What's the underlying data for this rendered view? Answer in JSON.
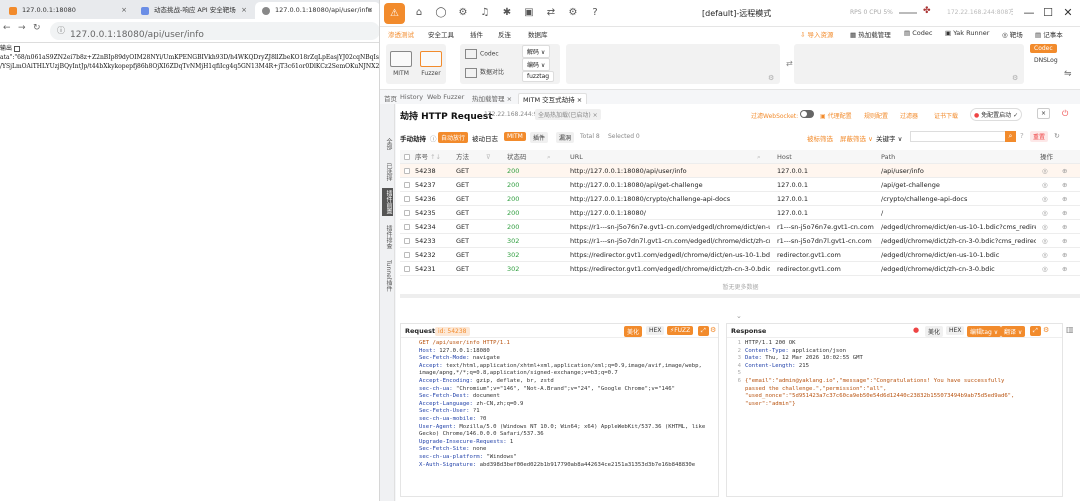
{
  "browser": {
    "tabs": [
      {
        "label": "127.0.0.1:18080",
        "active": false
      },
      {
        "label": "动态挑战-响应 API 安全靶场",
        "active": false
      },
      {
        "label": "127.0.0.1:18080/api/user/info",
        "active": true
      }
    ],
    "address": "127.0.0.1:18080/api/user/info",
    "content_lines": [
      "输出",
      "ata\":\"68/n061aS9ZN2ei7b8z+Z2nBIp89dyOIM28NYi/UmKPENGBIVkh93D/h4WKQDryZJ8llZbeKO18rZqLpEasjYJ02cqNBqIscfcbr",
      "/YSjLmOAiTHLYUzjBQyIntJp/t44bXkykopepfj86h8OjXI6ZDqTvNMjH1qfiIcg4q5GN13M4R+jT3c61or0DlKCz2SemOKuNJNX2Ilg"
    ]
  },
  "app": {
    "title": "[default]-远程模式",
    "stats": "RPS 0  CPU 5%",
    "ip": "172.22.168.244:8087",
    "menu": [
      "渗透测试",
      "安全工具",
      "插件",
      "反连",
      "数据库"
    ],
    "menu_right": [
      "导入资源",
      "热加载管理",
      "Codec",
      "Yak Runner",
      "靶场",
      "记事本"
    ],
    "tools": [
      "MITM",
      "Fuzzer",
      "Codec",
      "数据对比",
      "解码",
      "编码",
      "fuzztag"
    ],
    "side_tags": [
      "Codec",
      "DNSLog"
    ],
    "subtabs": [
      "首页",
      "History",
      "Web Fuzzer",
      "热加载管理",
      "MITM 交互式劫持"
    ],
    "vertical_sidebar": [
      "全部",
      "已选择",
      "插件前置",
      "插件排查",
      "Tunnel插件"
    ],
    "header": {
      "title": "劫持 HTTP Request",
      "addr": "172.22.168.244:9999",
      "mode": "全局热加载(已启动)",
      "ws_label": "过滤WebSocket:",
      "buttons": [
        "代理配置",
        "规则配置",
        "过滤器",
        "证书下载"
      ],
      "auto_forward": "免配置启动",
      "stop": "×"
    },
    "filter_row": {
      "hijack_label": "手动劫持",
      "auto_label": "自动放行",
      "log_label": "被动日志",
      "mitm_tag": "MITM",
      "plugin_tag": "插件",
      "risk_tag": "漏洞",
      "total": "Total 8",
      "selected": "Selected 0",
      "filter_left": "被标筛选",
      "filter_right": "屏蔽筛选",
      "keyword_label": "关键字",
      "reset": "重置"
    },
    "table": {
      "headers": [
        "序号",
        "方法",
        "状态码",
        "URL",
        "Host",
        "Path",
        "操作"
      ],
      "rows": [
        {
          "id": "54238",
          "method": "GET",
          "status": "200",
          "url": "http://127.0.0.1:18080/api/user/info",
          "host": "127.0.0.1",
          "path": "/api/user/info"
        },
        {
          "id": "54237",
          "method": "GET",
          "status": "200",
          "url": "http://127.0.0.1:18080/api/get-challenge",
          "host": "127.0.0.1",
          "path": "/api/get-challenge"
        },
        {
          "id": "54236",
          "method": "GET",
          "status": "200",
          "url": "http://127.0.0.1:18080/crypto/challenge-api-docs",
          "host": "127.0.0.1",
          "path": "/crypto/challenge-api-docs"
        },
        {
          "id": "54235",
          "method": "GET",
          "status": "200",
          "url": "http://127.0.0.1:18080/",
          "host": "127.0.0.1",
          "path": "/"
        },
        {
          "id": "54234",
          "method": "GET",
          "status": "200",
          "url": "https://r1---sn-j5o76n7e.gvt1-cn.com/edgedl/chrome/dict/en-us-10-...",
          "host": "r1---sn-j5o76n7e.gvt1-cn.com",
          "path": "/edgedl/chrome/dict/en-us-10-1.bdic?cms_redirect=yes"
        },
        {
          "id": "54233",
          "method": "GET",
          "status": "302",
          "url": "https://r1---sn-j5o7dn7l.gvt1-cn.com/edgedl/chrome/dict/zh-cn-3-0...",
          "host": "r1---sn-j5o7dn7l.gvt1-cn.com",
          "path": "/edgedl/chrome/dict/zh-cn-3-0.bdic?cms_redirect=yes"
        },
        {
          "id": "54232",
          "method": "GET",
          "status": "302",
          "url": "https://redirector.gvt1.com/edgedl/chrome/dict/en-us-10-1.bdic",
          "host": "redirector.gvt1.com",
          "path": "/edgedl/chrome/dict/en-us-10-1.bdic"
        },
        {
          "id": "54231",
          "method": "GET",
          "status": "302",
          "url": "https://redirector.gvt1.com/edgedl/chrome/dict/zh-cn-3-0.bdic",
          "host": "redirector.gvt1.com",
          "path": "/edgedl/chrome/dict/zh-cn-3-0.bdic"
        }
      ],
      "footer": "暂无更多数据"
    },
    "request": {
      "title": "Request",
      "id_tag": "id: 54238",
      "buttons": [
        "美化",
        "HEX",
        "FUZZ"
      ],
      "lines": [
        "GET /api/user/info HTTP/1.1",
        "Host: 127.0.0.1:18080",
        "Sec-Fetch-Mode: navigate",
        "Accept: text/html,application/xhtml+xml,application/xml;q=0.9,image/avif,image/webp,",
        "image/apng,*/*;q=0.8,application/signed-exchange;v=b3;q=0.7",
        "Accept-Encoding: gzip, deflate, br, zstd",
        "sec-ch-ua: \"Chromium\";v=\"146\", \"Not-A.Brand\";v=\"24\", \"Google Chrome\";v=\"146\"",
        "Sec-Fetch-Dest: document",
        "Accept-Language: zh-CN,zh;q=0.9",
        "Sec-Fetch-User: ?1",
        "sec-ch-ua-mobile: ?0",
        "User-Agent: Mozilla/5.0 (Windows NT 10.0; Win64; x64) AppleWebKit/537.36 (KHTML, like",
        "Gecko) Chrome/146.0.0.0 Safari/537.36",
        "Upgrade-Insecure-Requests: 1",
        "Sec-Fetch-Site: none",
        "sec-ch-ua-platform: \"Windows\"",
        "X-Auth-Signature: abd398d3bef00ed022b1b917790ab8a442634ce2151a31353d3b7e16b848830e"
      ]
    },
    "response": {
      "title": "Response",
      "buttons": [
        "美化",
        "HEX",
        "编辑tag",
        "翻译"
      ],
      "lines": [
        {
          "n": "1",
          "t": "HTTP/1.1 200 OK"
        },
        {
          "n": "2",
          "t": "Content-Type: application/json"
        },
        {
          "n": "3",
          "t": "Date: Thu, 12 Mar 2026 10:02:55 GMT"
        },
        {
          "n": "4",
          "t": "Content-Length: 215"
        },
        {
          "n": "5",
          "t": ""
        },
        {
          "n": "6",
          "t": "{\"email\":\"admin@yaklang.io\",\"message\":\"Congratulations! You have successfully"
        },
        {
          "n": "",
          "t": "passed the challenge.\",\"permission\":\"all\","
        },
        {
          "n": "",
          "t": "\"used_nonce\":\"5d951423a7c37c60ca9eb50e54d6d12440c23832b155073494b9ab75d5ed9ad6\","
        },
        {
          "n": "",
          "t": "\"user\":\"admin\"}"
        }
      ]
    },
    "colors": {
      "accent": "#f28b2c",
      "status_ok": "#2e9e3e"
    }
  }
}
